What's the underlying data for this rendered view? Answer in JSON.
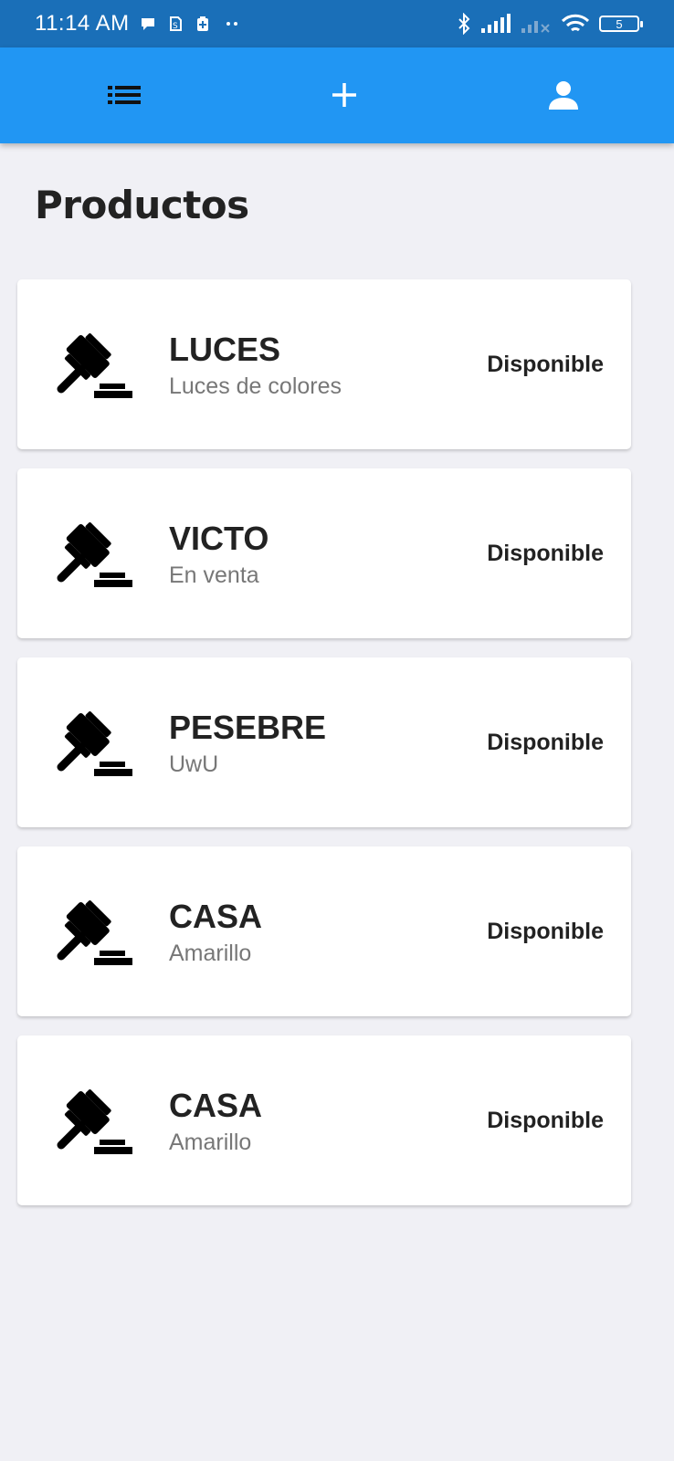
{
  "status_bar": {
    "time": "11:14 AM",
    "battery": "5",
    "left_icons": [
      "chat-bubble-icon",
      "sim-icon",
      "battery-saver-icon",
      "dots-icon"
    ],
    "right_icons": [
      "bluetooth-icon",
      "signal-icon",
      "signal-no-service-icon",
      "wifi-icon",
      "battery-icon"
    ]
  },
  "app_bar": {
    "color": "#2196f3",
    "buttons": [
      {
        "icon": "list-icon"
      },
      {
        "icon": "add-icon"
      },
      {
        "icon": "person-icon"
      }
    ]
  },
  "page": {
    "title": "Productos"
  },
  "products": [
    {
      "name": "LUCES",
      "description": "Luces de colores",
      "status": "Disponible",
      "icon": "gavel-icon"
    },
    {
      "name": "VICTO",
      "description": "En venta",
      "status": "Disponible",
      "icon": "gavel-icon"
    },
    {
      "name": "PESEBRE",
      "description": "UwU",
      "status": "Disponible",
      "icon": "gavel-icon"
    },
    {
      "name": "CASA",
      "description": "Amarillo",
      "status": "Disponible",
      "icon": "gavel-icon"
    },
    {
      "name": "CASA",
      "description": "Amarillo",
      "status": "Disponible",
      "icon": "gavel-icon"
    }
  ]
}
